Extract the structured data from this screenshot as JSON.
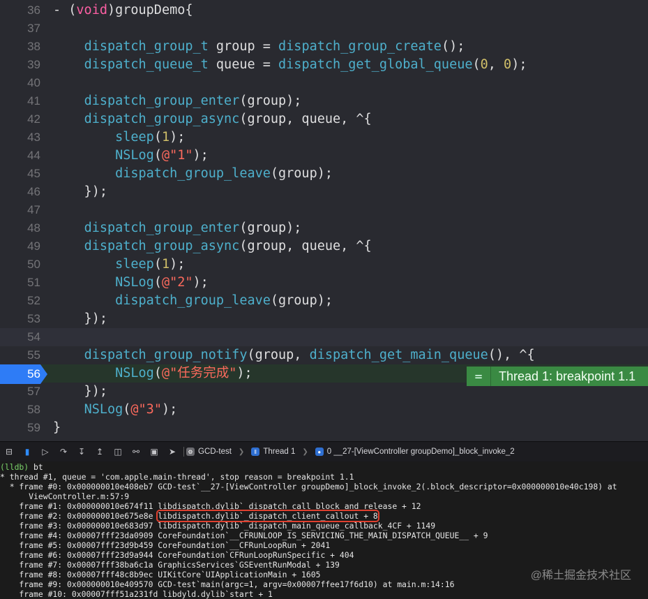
{
  "editor": {
    "lines": [
      {
        "n": "36",
        "tokens": [
          [
            "- (",
            ""
          ],
          [
            "void",
            "kw"
          ],
          [
            ")groupDemo{",
            ""
          ]
        ]
      },
      {
        "n": "37",
        "tokens": []
      },
      {
        "n": "38",
        "tokens": [
          [
            "    ",
            ""
          ],
          [
            "dispatch_group_t",
            "fn"
          ],
          [
            " group = ",
            ""
          ],
          [
            "dispatch_group_create",
            "fn"
          ],
          [
            "();",
            ""
          ]
        ]
      },
      {
        "n": "39",
        "tokens": [
          [
            "    ",
            ""
          ],
          [
            "dispatch_queue_t",
            "fn"
          ],
          [
            " queue = ",
            ""
          ],
          [
            "dispatch_get_global_queue",
            "fn"
          ],
          [
            "(",
            ""
          ],
          [
            "0",
            "num"
          ],
          [
            ", ",
            ""
          ],
          [
            "0",
            "num"
          ],
          [
            ");",
            ""
          ]
        ]
      },
      {
        "n": "40",
        "tokens": []
      },
      {
        "n": "41",
        "tokens": [
          [
            "    ",
            ""
          ],
          [
            "dispatch_group_enter",
            "fn"
          ],
          [
            "(group);",
            ""
          ]
        ]
      },
      {
        "n": "42",
        "tokens": [
          [
            "    ",
            ""
          ],
          [
            "dispatch_group_async",
            "fn"
          ],
          [
            "(group, queue, ^{",
            ""
          ]
        ]
      },
      {
        "n": "43",
        "tokens": [
          [
            "        ",
            ""
          ],
          [
            "sleep",
            "fn"
          ],
          [
            "(",
            ""
          ],
          [
            "1",
            "num"
          ],
          [
            ");",
            ""
          ]
        ]
      },
      {
        "n": "44",
        "tokens": [
          [
            "        ",
            ""
          ],
          [
            "NSLog",
            "fn"
          ],
          [
            "(",
            ""
          ],
          [
            "@\"1\"",
            "str"
          ],
          [
            ");",
            ""
          ]
        ]
      },
      {
        "n": "45",
        "tokens": [
          [
            "        ",
            ""
          ],
          [
            "dispatch_group_leave",
            "fn"
          ],
          [
            "(group);",
            ""
          ]
        ]
      },
      {
        "n": "46",
        "tokens": [
          [
            "    });",
            ""
          ]
        ]
      },
      {
        "n": "47",
        "tokens": []
      },
      {
        "n": "48",
        "tokens": [
          [
            "    ",
            ""
          ],
          [
            "dispatch_group_enter",
            "fn"
          ],
          [
            "(group);",
            ""
          ]
        ]
      },
      {
        "n": "49",
        "tokens": [
          [
            "    ",
            ""
          ],
          [
            "dispatch_group_async",
            "fn"
          ],
          [
            "(group, queue, ^{",
            ""
          ]
        ]
      },
      {
        "n": "50",
        "tokens": [
          [
            "        ",
            ""
          ],
          [
            "sleep",
            "fn"
          ],
          [
            "(",
            ""
          ],
          [
            "1",
            "num"
          ],
          [
            ");",
            ""
          ]
        ]
      },
      {
        "n": "51",
        "tokens": [
          [
            "        ",
            ""
          ],
          [
            "NSLog",
            "fn"
          ],
          [
            "(",
            ""
          ],
          [
            "@\"2\"",
            "str"
          ],
          [
            ");",
            ""
          ]
        ]
      },
      {
        "n": "52",
        "tokens": [
          [
            "        ",
            ""
          ],
          [
            "dispatch_group_leave",
            "fn"
          ],
          [
            "(group);",
            ""
          ]
        ]
      },
      {
        "n": "53",
        "tokens": [
          [
            "    });",
            ""
          ]
        ]
      },
      {
        "n": "54",
        "tokens": []
      },
      {
        "n": "55",
        "tokens": [
          [
            "    ",
            ""
          ],
          [
            "dispatch_group_notify",
            "fn"
          ],
          [
            "(group, ",
            ""
          ],
          [
            "dispatch_get_main_queue",
            "fn"
          ],
          [
            "(), ^{",
            ""
          ]
        ]
      },
      {
        "n": "56",
        "tokens": [
          [
            "        ",
            ""
          ],
          [
            "NSLog",
            "fn"
          ],
          [
            "(",
            ""
          ],
          [
            "@\"任务完成\"",
            "str"
          ],
          [
            ");",
            ""
          ]
        ]
      },
      {
        "n": "57",
        "tokens": [
          [
            "    });",
            ""
          ]
        ]
      },
      {
        "n": "58",
        "tokens": [
          [
            "    ",
            ""
          ],
          [
            "NSLog",
            "fn"
          ],
          [
            "(",
            ""
          ],
          [
            "@\"3\"",
            "str"
          ],
          [
            ");",
            ""
          ]
        ]
      },
      {
        "n": "59",
        "tokens": [
          [
            "}",
            ""
          ]
        ]
      }
    ],
    "current_line": "54",
    "breakpoint_line": "56",
    "breakpoint_banner": "Thread 1: breakpoint 1.1",
    "breakpoint_banner_icon": "="
  },
  "debug_bar": {
    "target": "GCD-test",
    "thread": "Thread 1",
    "frame": "0 __27-[ViewController groupDemo]_block_invoke_2"
  },
  "console": {
    "lines": [
      {
        "prompt": "(lldb)",
        "text": " bt"
      },
      {
        "text": "* thread #1, queue = 'com.apple.main-thread', stop reason = breakpoint 1.1"
      },
      {
        "text": "  * frame #0: 0x000000010e408eb7 GCD-test`__27-[ViewController groupDemo]_block_invoke_2(.block_descriptor=0x000000010e40c198) at"
      },
      {
        "text": "      ViewController.m:57:9"
      },
      {
        "text": "    frame #1: 0x000000010e674f11 libdispatch.dylib`_dispatch_call_block_and_release + 12"
      },
      {
        "pre": "    frame #2: 0x000000010e675e8e ",
        "hl": "libdispatch.dylib`_dispatch_client_callout + 8"
      },
      {
        "text": "    frame #3: 0x000000010e683d97 libdispatch.dylib`_dispatch_main_queue_callback_4CF + 1149"
      },
      {
        "text": "    frame #4: 0x00007fff23da0909 CoreFoundation`__CFRUNLOOP_IS_SERVICING_THE_MAIN_DISPATCH_QUEUE__ + 9"
      },
      {
        "text": "    frame #5: 0x00007fff23d9b459 CoreFoundation`__CFRunLoopRun + 2041"
      },
      {
        "text": "    frame #6: 0x00007fff23d9a944 CoreFoundation`CFRunLoopRunSpecific + 404"
      },
      {
        "text": "    frame #7: 0x00007fff38ba6c1a GraphicsServices`GSEventRunModal + 139"
      },
      {
        "text": "    frame #8: 0x00007fff48c8b9ec UIKitCore`UIApplicationMain + 1605"
      },
      {
        "text": "    frame #9: 0x000000010e409570 GCD-test`main(argc=1, argv=0x00007ffee17f6d10) at main.m:14:16"
      },
      {
        "text": "    frame #10: 0x00007fff51a231fd libdyld.dylib`start + 1"
      }
    ]
  },
  "watermark": "@稀土掘金技术社区",
  "colors": {
    "function": "#4eb0cc",
    "keyword": "#fc5fa3",
    "number": "#d0bf69",
    "string": "#fc6a5d",
    "breakpoint": "#2e7cf6",
    "banner": "#3a8a43"
  }
}
